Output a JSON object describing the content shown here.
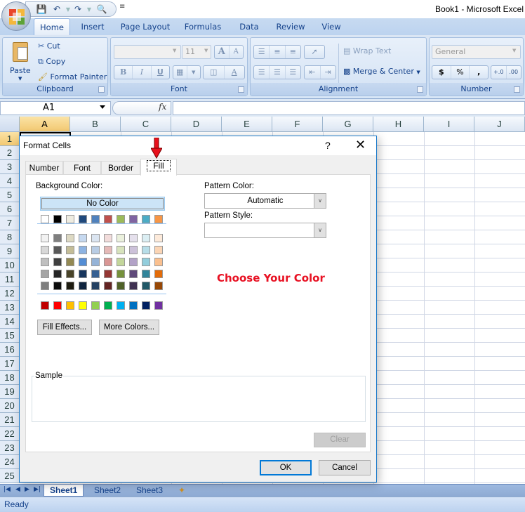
{
  "window": {
    "title": "Book1 - Microsoft Excel"
  },
  "quick_access": {
    "icons": [
      "save-icon",
      "undo-icon",
      "redo-icon",
      "print-preview-icon",
      "customize-qat-icon"
    ]
  },
  "ribbon": {
    "tabs": [
      {
        "label": "Home",
        "active": true
      },
      {
        "label": "Insert"
      },
      {
        "label": "Page Layout"
      },
      {
        "label": "Formulas"
      },
      {
        "label": "Data"
      },
      {
        "label": "Review"
      },
      {
        "label": "View"
      }
    ],
    "clipboard": {
      "label": "Clipboard",
      "paste": "Paste",
      "cut": "Cut",
      "copy": "Copy",
      "format_painter": "Format Painter"
    },
    "font": {
      "label": "Font",
      "font_name": "",
      "font_size": "11",
      "bold": "B",
      "italic": "I",
      "underline": "U",
      "grow": "A",
      "shrink": "A",
      "font_color": "A"
    },
    "alignment": {
      "label": "Alignment",
      "wrap_text": "Wrap Text",
      "merge_center": "Merge & Center"
    },
    "number": {
      "label": "Number",
      "format": "General",
      "currency": "$",
      "percent": "%",
      "comma": ",",
      "inc_decimal": "+.0",
      "dec_decimal": ".00"
    }
  },
  "formula_bar": {
    "name_box": "A1",
    "fx": "fx",
    "formula": ""
  },
  "grid": {
    "columns": [
      "A",
      "B",
      "C",
      "D",
      "E",
      "F",
      "G",
      "H",
      "I",
      "J"
    ],
    "selected_column": "A",
    "rows": [
      "1",
      "2",
      "3",
      "4",
      "5",
      "6",
      "7",
      "8",
      "9",
      "10",
      "11",
      "12",
      "13",
      "14",
      "15",
      "16",
      "17",
      "18",
      "19",
      "20",
      "21",
      "22",
      "23",
      "24",
      "25"
    ],
    "selected_row": "1",
    "active_cell": "A1"
  },
  "sheets": {
    "tabs": [
      "Sheet1",
      "Sheet2",
      "Sheet3"
    ],
    "active": "Sheet1",
    "nav": [
      "first",
      "prev",
      "next",
      "last"
    ]
  },
  "status": {
    "text": "Ready"
  },
  "dialog": {
    "title": "Format Cells",
    "help": "?",
    "close": "✕",
    "tabs": [
      "Number",
      "Font",
      "Border",
      "Fill"
    ],
    "active_tab": "Fill",
    "background_color_label": "Background Color:",
    "no_color": "No Color",
    "theme_row": [
      "#FFFFFF",
      "#000000",
      "#EEECE1",
      "#1F497D",
      "#4F81BD",
      "#C0504D",
      "#9BBB59",
      "#8064A2",
      "#4BACC6",
      "#F79646"
    ],
    "tint_rows": [
      [
        "#F2F2F2",
        "#7F7F7F",
        "#DDD9C3",
        "#C6D9F0",
        "#DBE5F1",
        "#F2DCDB",
        "#EBF1DD",
        "#E5E0EC",
        "#DBEEF3",
        "#FDEADA"
      ],
      [
        "#D8D8D8",
        "#595959",
        "#C4BD97",
        "#8DB3E2",
        "#B8CCE4",
        "#E5B9B7",
        "#D7E3BC",
        "#CCC1D9",
        "#B7DDE8",
        "#FBD5B5"
      ],
      [
        "#BFBFBF",
        "#3F3F3F",
        "#938953",
        "#548DD4",
        "#95B3D7",
        "#D99694",
        "#C3D69B",
        "#B2A2C7",
        "#92CDDC",
        "#FAC08F"
      ],
      [
        "#A5A5A5",
        "#262626",
        "#494429",
        "#17365D",
        "#366092",
        "#953734",
        "#76923C",
        "#5F497A",
        "#31859B",
        "#E36C09"
      ],
      [
        "#7F7F7F",
        "#0C0C0C",
        "#1D1B10",
        "#0F243E",
        "#244061",
        "#632423",
        "#4F6128",
        "#3F3151",
        "#205867",
        "#974806"
      ]
    ],
    "standard_row": [
      "#C00000",
      "#FF0000",
      "#FFC000",
      "#FFFF00",
      "#92D050",
      "#00B050",
      "#00B0F0",
      "#0070C0",
      "#002060",
      "#7030A0"
    ],
    "fill_effects": "Fill Effects...",
    "more_colors": "More Colors...",
    "pattern_color_label": "Pattern Color:",
    "pattern_color_value": "Automatic",
    "pattern_style_label": "Pattern Style:",
    "pattern_style_value": "",
    "annotation": "Choose Your Color",
    "annotation_color": "#E81123",
    "sample_label": "Sample",
    "clear": "Clear",
    "ok": "OK",
    "cancel": "Cancel"
  }
}
